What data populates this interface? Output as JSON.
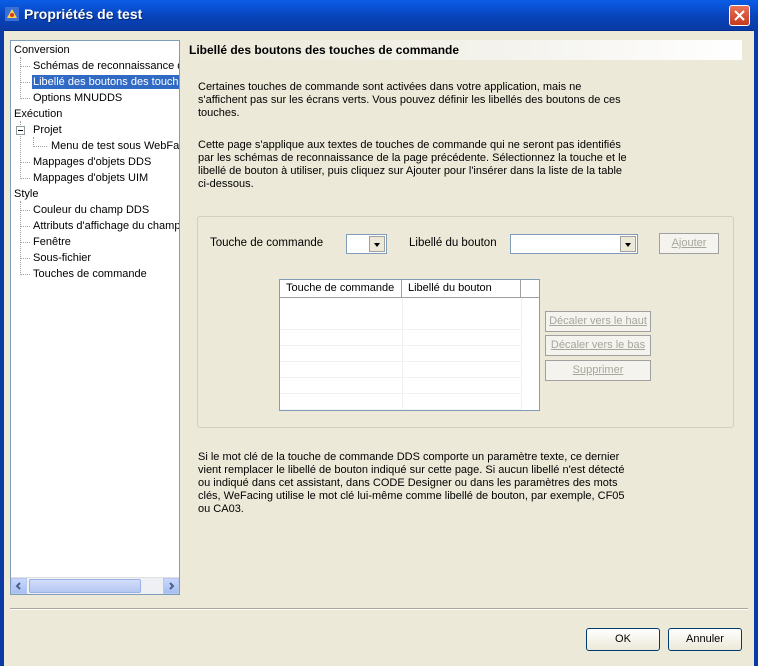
{
  "window": {
    "title": "Propriétés de test"
  },
  "tree": {
    "items": [
      {
        "label": "Conversion"
      },
      {
        "label": "Schémas de reconnaissance d"
      },
      {
        "label": "Libellé des boutons des touche"
      },
      {
        "label": "Options MNUDDS"
      },
      {
        "label": "Exécution"
      },
      {
        "label": "Projet"
      },
      {
        "label": "Menu de test sous WebFac"
      },
      {
        "label": "Mappages d'objets DDS"
      },
      {
        "label": "Mappages d'objets UIM"
      },
      {
        "label": "Style"
      },
      {
        "label": "Couleur du champ DDS"
      },
      {
        "label": "Attributs d'affichage du champ"
      },
      {
        "label": "Fenêtre"
      },
      {
        "label": "Sous-fichier"
      },
      {
        "label": "Touches de commande"
      }
    ]
  },
  "page": {
    "title": "Libellé des boutons des touches de commande",
    "para1": [
      "Certaines touches de commande sont activées dans votre application, mais ne",
      "s'affichent pas sur les écrans verts.  Vous pouvez définir les libellés des boutons de ces",
      "touches."
    ],
    "para2": [
      "Cette page s'applique aux textes de touches de commande qui ne seront pas identifiés",
      "par les schémas de reconnaissance de la page précédente.  Sélectionnez la touche et le",
      "libellé de bouton à utiliser, puis cliquez sur Ajouter pour l'insérer dans la liste de la table",
      "ci-dessous."
    ],
    "para3": [
      "Si le mot clé de la touche de commande DDS comporte un paramètre texte, ce dernier",
      "vient remplacer le libellé de bouton indiqué sur cette page.  Si aucun libellé n'est détecté",
      "ou indiqué dans cet assistant, dans CODE Designer ou dans les paramètres des mots",
      "clés, WeFacing utilise le mot clé lui-même comme libellé de bouton, par exemple, CF05",
      "ou CA03."
    ]
  },
  "form": {
    "key_label": "Touche de commande",
    "key_value": "",
    "button_label": "Libellé du bouton",
    "button_value": "",
    "add": "Ajouter",
    "table_headers": [
      "Touche de commande",
      "Libellé du bouton"
    ],
    "move_up": "Décaler vers le haut",
    "move_down": "Décaler vers le bas",
    "delete": "Supprimer"
  },
  "footer": {
    "ok": "OK",
    "cancel": "Annuler"
  }
}
